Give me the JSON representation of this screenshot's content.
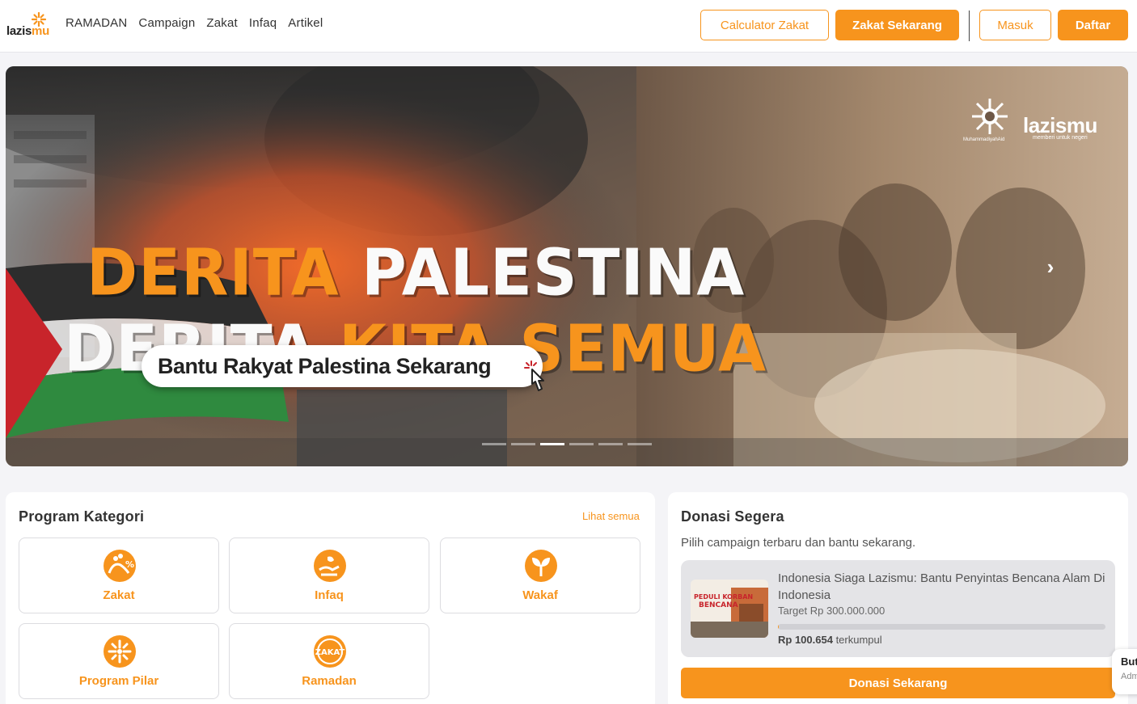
{
  "brand": {
    "logo_text_a": "lazis",
    "logo_text_b": "mu",
    "accent": "#f7941d"
  },
  "nav": [
    "RAMADAN",
    "Campaign",
    "Zakat",
    "Infaq",
    "Artikel"
  ],
  "header_buttons": {
    "calculator": "Calculator Zakat",
    "zakat_now": "Zakat Sekarang",
    "login": "Masuk",
    "register": "Daftar"
  },
  "hero": {
    "line1_a": "DERITA",
    "line1_b": "PALESTINA",
    "line2_a": "DERITA",
    "line2_b": "KITA SEMUA",
    "cta": "Bantu Rakyat Palestina Sekarang",
    "logo_right": "lazismu",
    "logo_right_tag": "memberi untuk negeri",
    "logo_left_tag": "MuhammadiyahAid",
    "slides_total": 6,
    "slide_active": 3
  },
  "program": {
    "title": "Program Kategori",
    "see_all": "Lihat semua",
    "items": [
      {
        "label": "Zakat",
        "icon": "zakat-icon"
      },
      {
        "label": "Infaq",
        "icon": "infaq-icon"
      },
      {
        "label": "Wakaf",
        "icon": "wakaf-icon"
      },
      {
        "label": "Program Pilar",
        "icon": "program-pilar-icon"
      },
      {
        "label": "Ramadan",
        "icon": "ramadan-icon"
      }
    ]
  },
  "donasi": {
    "title": "Donasi Segera",
    "subtitle": "Pilih campaign terbaru dan bantu sekarang.",
    "campaign": {
      "title": "Indonesia Siaga Lazismu: Bantu Penyintas Bencana Alam Di Indonesia",
      "target": "Target Rp 300.000.000",
      "raised_amount": "Rp 100.654",
      "raised_suffix": "terkumpul",
      "progress_fraction": 0.0003,
      "thumb_text_1": "PEDULI KORBAN",
      "thumb_text_2": "BENCANA"
    },
    "button": "Donasi Sekarang"
  },
  "chat": {
    "title": "But",
    "subtitle": "Adm"
  }
}
